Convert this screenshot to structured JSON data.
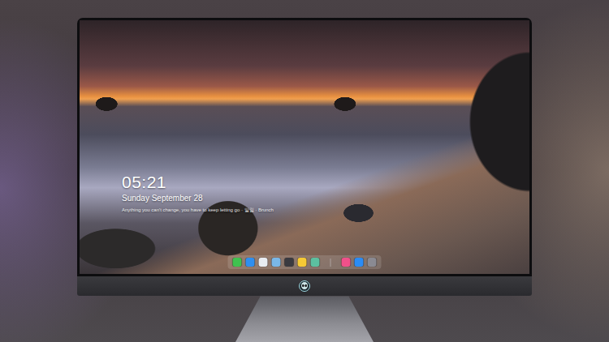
{
  "lock_screen": {
    "time": "05:21",
    "date": "Sunday September 28",
    "message": "Anything you can't change, you have to keep letting go · 알림 · Brunch"
  },
  "dock": {
    "items": [
      {
        "kind": "app",
        "color": "#3fc24f"
      },
      {
        "kind": "app",
        "color": "#2f8ff0"
      },
      {
        "kind": "app",
        "color": "#e8ecf2"
      },
      {
        "kind": "app",
        "color": "#7ab8e8"
      },
      {
        "kind": "app",
        "color": "#3a3a40"
      },
      {
        "kind": "app",
        "color": "#f5c935"
      },
      {
        "kind": "app",
        "color": "#5cc0a0"
      },
      {
        "kind": "separator",
        "color": "#cfcfd6"
      },
      {
        "kind": "app",
        "color": "#f0508a"
      },
      {
        "kind": "app",
        "color": "#2a8cf5"
      },
      {
        "kind": "app",
        "color": "#8a8a92"
      }
    ]
  }
}
